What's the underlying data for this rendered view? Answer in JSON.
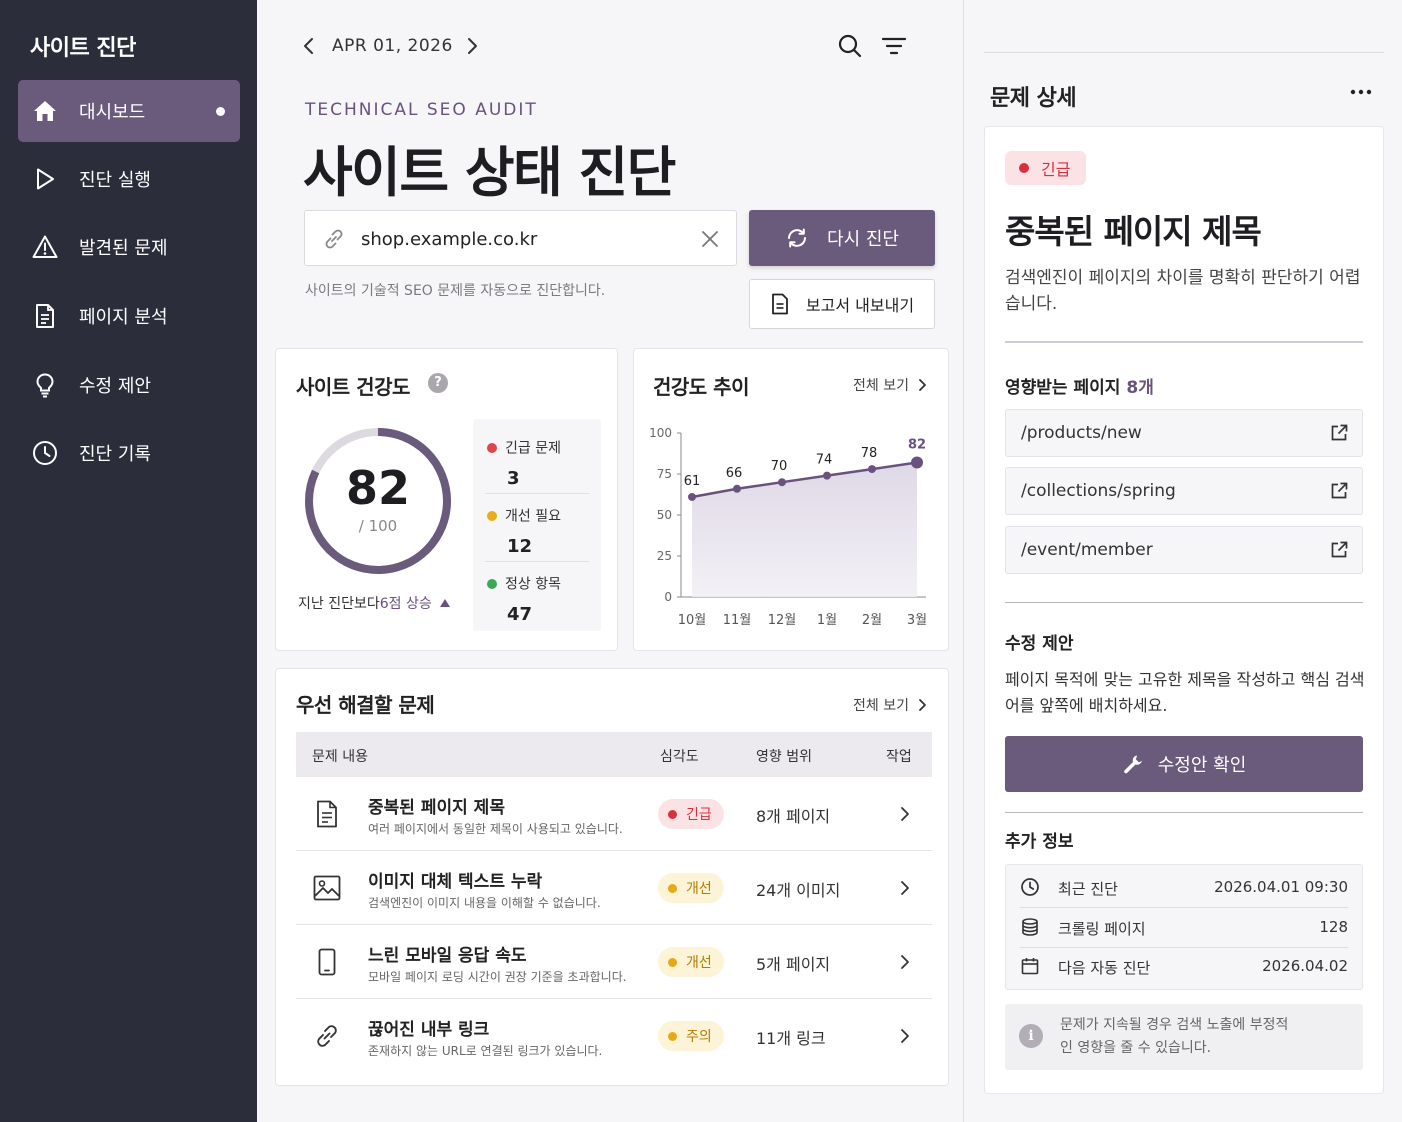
{
  "sidebar": {
    "title": "사이트 진단",
    "items": [
      {
        "label": "대시보드",
        "icon": "home-icon"
      },
      {
        "label": "진단 실행",
        "icon": "play-icon"
      },
      {
        "label": "발견된 문제",
        "icon": "warning-icon"
      },
      {
        "label": "페이지 분석",
        "icon": "document-icon"
      },
      {
        "label": "수정 제안",
        "icon": "lightbulb-icon"
      },
      {
        "label": "진단 기록",
        "icon": "clock-icon"
      }
    ]
  },
  "datebar": {
    "date": "APR 01, 2026"
  },
  "header": {
    "eyebrow": "TECHNICAL SEO AUDIT",
    "title": "사이트 상태 진단",
    "url_value": "shop.example.co.kr",
    "helper": "사이트의 기술적 SEO 문제를 자동으로 진단합니다.",
    "rerun_label": "다시 진단",
    "export_label": "보고서 내보내기"
  },
  "health": {
    "title": "사이트 건강도",
    "score": "82",
    "score_fraction": 0.82,
    "max": "/ 100",
    "trend_prefix": "지난 진단보다 ",
    "trend_value": "6점 상승",
    "stats": [
      {
        "label": "긴급 문제",
        "value": "3",
        "color": "#e0444f"
      },
      {
        "label": "개선 필요",
        "value": "12",
        "color": "#e8ad18"
      },
      {
        "label": "정상 항목",
        "value": "47",
        "color": "#3aaa57"
      }
    ]
  },
  "trend": {
    "title": "건강도 추이",
    "view_all": "전체 보기"
  },
  "chart_data": {
    "type": "area",
    "categories": [
      "10월",
      "11월",
      "12월",
      "1월",
      "2월",
      "3월"
    ],
    "values": [
      61,
      66,
      70,
      74,
      78,
      82
    ],
    "ylim": [
      0,
      100
    ],
    "yticks": [
      0,
      25,
      50,
      75,
      100
    ],
    "data_labels": [
      "61",
      "66",
      "70",
      "74",
      "78",
      "82"
    ],
    "grid": false,
    "line_color": "#6a527e",
    "highlight_last": true
  },
  "issues": {
    "title": "우선 해결할 문제",
    "view_all": "전체 보기",
    "columns": [
      "문제 내용",
      "심각도",
      "영향 범위",
      "작업"
    ],
    "rows": [
      {
        "title": "중복된 페이지 제목",
        "desc": "여러 페이지에서 동일한 제목이 사용되고 있습니다.",
        "severity": "긴급",
        "severity_kind": "urgent",
        "scope": "8개 페이지",
        "icon": "document-icon"
      },
      {
        "title": "이미지 대체 텍스트 누락",
        "desc": "검색엔진이 이미지 내용을 이해할 수 없습니다.",
        "severity": "개선",
        "severity_kind": "improve",
        "scope": "24개 이미지",
        "icon": "image-icon"
      },
      {
        "title": "느린 모바일 응답 속도",
        "desc": "모바일 페이지 로딩 시간이 권장 기준을 초과합니다.",
        "severity": "개선",
        "severity_kind": "improve",
        "scope": "5개 페이지",
        "icon": "mobile-icon"
      },
      {
        "title": "끊어진 내부 링크",
        "desc": "존재하지 않는 URL로 연결된 링크가 있습니다.",
        "severity": "주의",
        "severity_kind": "improve",
        "scope": "11개 링크",
        "icon": "link-icon"
      }
    ]
  },
  "detail": {
    "panel_title": "문제 상세",
    "badge": "긴급",
    "title": "중복된 페이지 제목",
    "desc": "검색엔진이 페이지의 차이를 명확히 판단하기 어렵습니다.",
    "affected_title": "영향받는 페이지",
    "affected_count": "8개",
    "pages": [
      "/products/new",
      "/collections/spring",
      "/event/member"
    ],
    "fix_title": "수정 제안",
    "fix_text": "페이지 목적에 맞는 고유한 제목을 작성하고 핵심 검색어를 앞쪽에 배치하세요.",
    "fix_button": "수정안 확인",
    "info_title": "추가 정보",
    "info": [
      {
        "key": "최근 진단",
        "value": "2026.04.01 09:30",
        "icon": "clock-icon"
      },
      {
        "key": "크롤링 페이지",
        "value": "128",
        "icon": "database-icon"
      },
      {
        "key": "다음 자동 진단",
        "value": "2026.04.02",
        "icon": "calendar-icon"
      }
    ],
    "note": "문제가 지속될 경우 검색 노출에 부정적인 영향을 줄 수 있습니다."
  },
  "colors": {
    "accent": "#6a5a7c",
    "sidebar": "#2b2d3b",
    "urgent": "#d93040",
    "improve": "#e6a914"
  }
}
